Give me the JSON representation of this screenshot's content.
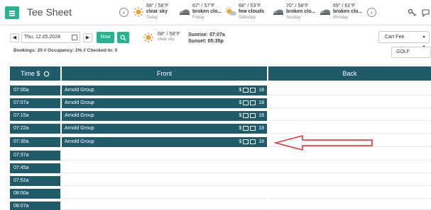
{
  "app": {
    "title": "Tee Sheet"
  },
  "weather": {
    "prev_label": "‹",
    "next_label": "›",
    "days": [
      {
        "temp": "68° / 58°F",
        "desc": "clear sky",
        "when": "Today",
        "icon": "sun-icon"
      },
      {
        "temp": "67° / 57°F",
        "desc": "broken clo...",
        "when": "Friday",
        "icon": "cloud-icon"
      },
      {
        "temp": "68° / 53°F",
        "desc": "few clouds",
        "when": "Saturday",
        "icon": "sun-cloud-icon"
      },
      {
        "temp": "70° / 58°F",
        "desc": "broken clo...",
        "when": "Sunday",
        "icon": "cloud-icon"
      },
      {
        "temp": "69° / 61°F",
        "desc": "broken clo...",
        "when": "Monday",
        "icon": "cloud-icon"
      }
    ]
  },
  "toolbar": {
    "date_value": "Thu, 12.05.2024",
    "now_label": "Now",
    "current_temp": "68° / 58°F",
    "current_desc": "clear sky",
    "sunrise": "Sunrise: 07:07a",
    "sunset": "Sunset: 05:35p",
    "stats": "Bookings: 20 // Occupancy: 2% // Checked-In: 0",
    "cart_fee": "Cart Fee",
    "course": "GOLF"
  },
  "grid": {
    "time_header": "Time $",
    "front_header": "Front",
    "back_header": "Back",
    "times": [
      "07:00a",
      "07:07a",
      "07:15a",
      "07:22a",
      "07:30a",
      "07:37a",
      "07:45a",
      "07:52a",
      "08:00a",
      "08:07a"
    ],
    "front_bookings": [
      {
        "group": "Arnold Group",
        "dollar": "$",
        "holes": "18"
      },
      {
        "group": "Arnold Group",
        "dollar": "$",
        "holes": "18"
      },
      {
        "group": "Arnold Group",
        "dollar": "$",
        "holes": "18"
      },
      {
        "group": "Arnold Group",
        "dollar": "$",
        "holes": "18"
      },
      {
        "group": "Arnold Group",
        "dollar": "$",
        "holes": "18"
      }
    ]
  },
  "colors": {
    "accent": "#27b38f",
    "header": "#1f5b6a",
    "arrow": "#e02020"
  }
}
